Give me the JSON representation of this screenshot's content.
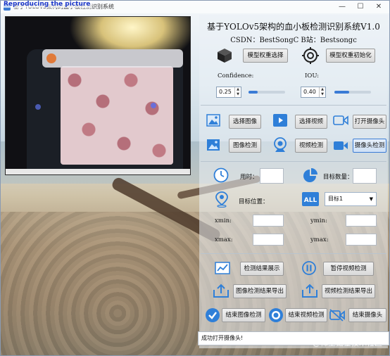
{
  "window": {
    "title": "基于YOLOv5架构的血小板检测识别系统",
    "controls": [
      "—",
      "☐",
      "✕"
    ]
  },
  "video": {
    "label": "Reproducing the picture"
  },
  "header": {
    "title": "基于YOLOv5架构的血小板检测识别系统V1.0",
    "subtitle": "CSDN：BestSongC  B站：Bestsongc"
  },
  "model": {
    "select_label": "模型权重选择",
    "init_label": "模型权重初始化"
  },
  "confidence": {
    "label": "Confidence:",
    "value": "0.25",
    "level": 0.25
  },
  "iou": {
    "label": "IOU:",
    "value": "0.40",
    "level": 0.4
  },
  "buttons": {
    "select_image": "选择图像",
    "select_video": "选择视频",
    "open_camera": "打开摄像头",
    "image_detect": "图像检测",
    "video_detect": "视频检测",
    "camera_detect": "摄像头检测"
  },
  "stats": {
    "time_label": "用时：",
    "target_count_label": "目标数量：",
    "target_position_label": "目标位置：",
    "target_select_value": "目标1",
    "xmin_label": "xmin:",
    "ymin_label": "ymin:",
    "xmax_label": "xmax:",
    "ymax_label": "ymax:"
  },
  "actions": {
    "show_results": "检测结果展示",
    "pause_video": "暂停视频检测",
    "export_image": "图像检测结果导出",
    "export_video": "视频检测结果导出",
    "end_image": "结束图像检测",
    "end_video": "结束视频检测",
    "end_camera": "结束摄像头"
  },
  "status": {
    "text": "成功打开摄像头!"
  },
  "watermark": "@稀土掘金技术社区",
  "colors": {
    "accent": "#3a7bd5",
    "icon_blue": "#2f7fd8",
    "icon_orange": "#e07a3a"
  }
}
